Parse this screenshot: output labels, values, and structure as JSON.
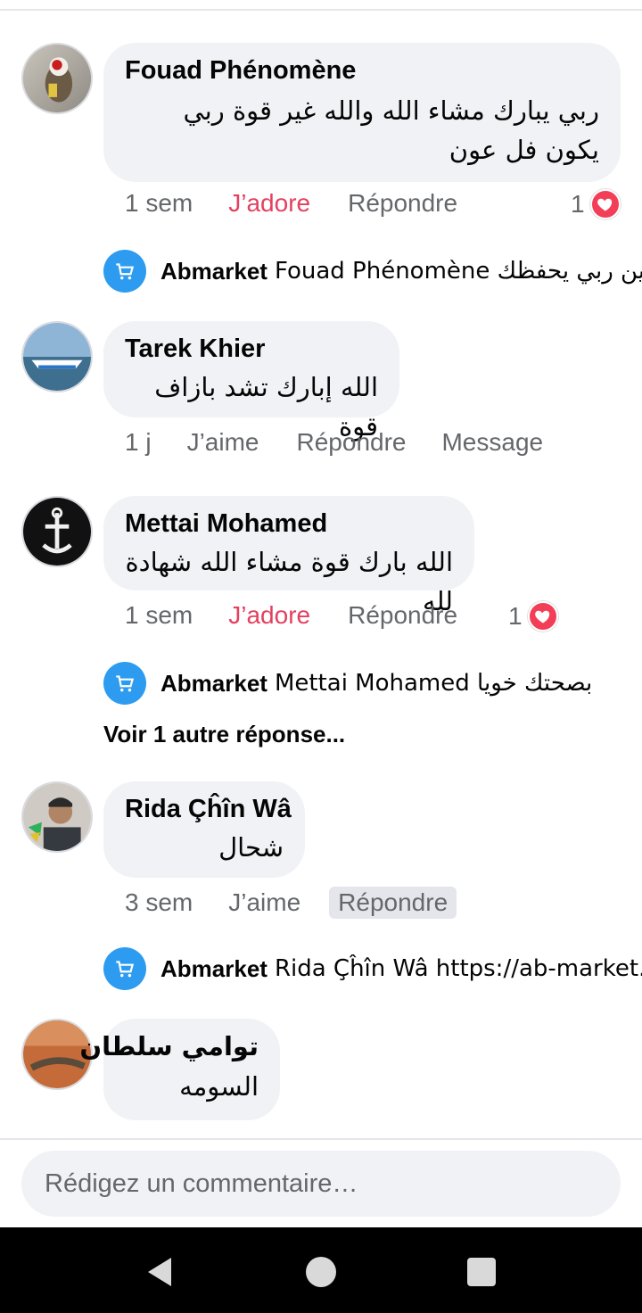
{
  "comments": [
    {
      "author": "Fouad Phénomène",
      "text": "ربي يبارك مشاء الله والله غير قوة ربي يكون فل عون",
      "time": "1 sem",
      "like_label": "J’adore",
      "reply_label": "Répondre",
      "reaction_count": "1",
      "reply": {
        "author": "Abmarket",
        "text": "Fouad Phénomène امين ربي يحفظك"
      }
    },
    {
      "author": "Tarek Khier",
      "text": "الله إبارك  تشد بازاف قوة",
      "time": "1 j",
      "like_label": "J’aime",
      "reply_label": "Répondre",
      "message_label": "Message"
    },
    {
      "author": "Mettai Mohamed",
      "text": "الله بارك قوة مشاء الله شهادة لله",
      "time": "1 sem",
      "like_label": "J’adore",
      "reply_label": "Répondre",
      "reaction_count": "1",
      "reply": {
        "author": "Abmarket",
        "text": "Mettai Mohamed بصحتك خويا"
      },
      "more_replies": "Voir 1 autre réponse..."
    },
    {
      "author": "Rida Çĥîn Wâ",
      "text": "شحال",
      "time": "3 sem",
      "like_label": "J’aime",
      "reply_label": "Répondre",
      "reply": {
        "author": "Abmarket",
        "text": "Rida Çĥîn Wâ https://ab-market...."
      }
    },
    {
      "author": "توامي سلطان",
      "text": "السومه"
    }
  ],
  "composer": {
    "placeholder": "Rédigez un commentaire…"
  },
  "colors": {
    "adore": "#e4405f",
    "bubble": "#f0f2f5",
    "muted": "#65676b",
    "brand": "#2d9cf0"
  },
  "nav": [
    "back-icon",
    "home-icon",
    "recents-icon"
  ]
}
